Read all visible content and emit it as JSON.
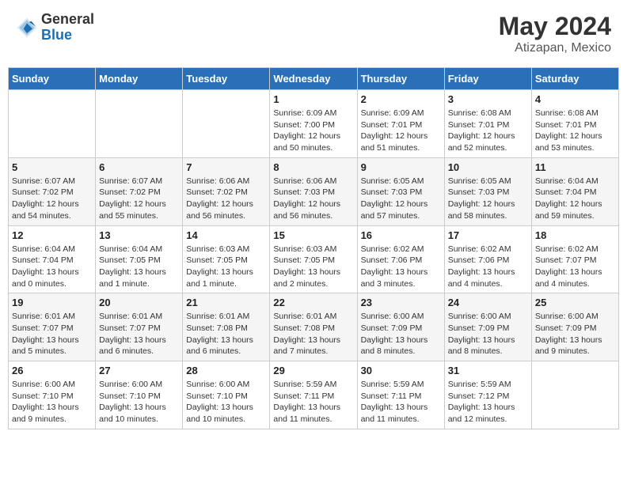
{
  "header": {
    "logo_general": "General",
    "logo_blue": "Blue",
    "month_year": "May 2024",
    "location": "Atizapan, Mexico"
  },
  "weekdays": [
    "Sunday",
    "Monday",
    "Tuesday",
    "Wednesday",
    "Thursday",
    "Friday",
    "Saturday"
  ],
  "weeks": [
    [
      {
        "day": "",
        "info": ""
      },
      {
        "day": "",
        "info": ""
      },
      {
        "day": "",
        "info": ""
      },
      {
        "day": "1",
        "info": "Sunrise: 6:09 AM\nSunset: 7:00 PM\nDaylight: 12 hours\nand 50 minutes."
      },
      {
        "day": "2",
        "info": "Sunrise: 6:09 AM\nSunset: 7:01 PM\nDaylight: 12 hours\nand 51 minutes."
      },
      {
        "day": "3",
        "info": "Sunrise: 6:08 AM\nSunset: 7:01 PM\nDaylight: 12 hours\nand 52 minutes."
      },
      {
        "day": "4",
        "info": "Sunrise: 6:08 AM\nSunset: 7:01 PM\nDaylight: 12 hours\nand 53 minutes."
      }
    ],
    [
      {
        "day": "5",
        "info": "Sunrise: 6:07 AM\nSunset: 7:02 PM\nDaylight: 12 hours\nand 54 minutes."
      },
      {
        "day": "6",
        "info": "Sunrise: 6:07 AM\nSunset: 7:02 PM\nDaylight: 12 hours\nand 55 minutes."
      },
      {
        "day": "7",
        "info": "Sunrise: 6:06 AM\nSunset: 7:02 PM\nDaylight: 12 hours\nand 56 minutes."
      },
      {
        "day": "8",
        "info": "Sunrise: 6:06 AM\nSunset: 7:03 PM\nDaylight: 12 hours\nand 56 minutes."
      },
      {
        "day": "9",
        "info": "Sunrise: 6:05 AM\nSunset: 7:03 PM\nDaylight: 12 hours\nand 57 minutes."
      },
      {
        "day": "10",
        "info": "Sunrise: 6:05 AM\nSunset: 7:03 PM\nDaylight: 12 hours\nand 58 minutes."
      },
      {
        "day": "11",
        "info": "Sunrise: 6:04 AM\nSunset: 7:04 PM\nDaylight: 12 hours\nand 59 minutes."
      }
    ],
    [
      {
        "day": "12",
        "info": "Sunrise: 6:04 AM\nSunset: 7:04 PM\nDaylight: 13 hours\nand 0 minutes."
      },
      {
        "day": "13",
        "info": "Sunrise: 6:04 AM\nSunset: 7:05 PM\nDaylight: 13 hours\nand 1 minute."
      },
      {
        "day": "14",
        "info": "Sunrise: 6:03 AM\nSunset: 7:05 PM\nDaylight: 13 hours\nand 1 minute."
      },
      {
        "day": "15",
        "info": "Sunrise: 6:03 AM\nSunset: 7:05 PM\nDaylight: 13 hours\nand 2 minutes."
      },
      {
        "day": "16",
        "info": "Sunrise: 6:02 AM\nSunset: 7:06 PM\nDaylight: 13 hours\nand 3 minutes."
      },
      {
        "day": "17",
        "info": "Sunrise: 6:02 AM\nSunset: 7:06 PM\nDaylight: 13 hours\nand 4 minutes."
      },
      {
        "day": "18",
        "info": "Sunrise: 6:02 AM\nSunset: 7:07 PM\nDaylight: 13 hours\nand 4 minutes."
      }
    ],
    [
      {
        "day": "19",
        "info": "Sunrise: 6:01 AM\nSunset: 7:07 PM\nDaylight: 13 hours\nand 5 minutes."
      },
      {
        "day": "20",
        "info": "Sunrise: 6:01 AM\nSunset: 7:07 PM\nDaylight: 13 hours\nand 6 minutes."
      },
      {
        "day": "21",
        "info": "Sunrise: 6:01 AM\nSunset: 7:08 PM\nDaylight: 13 hours\nand 6 minutes."
      },
      {
        "day": "22",
        "info": "Sunrise: 6:01 AM\nSunset: 7:08 PM\nDaylight: 13 hours\nand 7 minutes."
      },
      {
        "day": "23",
        "info": "Sunrise: 6:00 AM\nSunset: 7:09 PM\nDaylight: 13 hours\nand 8 minutes."
      },
      {
        "day": "24",
        "info": "Sunrise: 6:00 AM\nSunset: 7:09 PM\nDaylight: 13 hours\nand 8 minutes."
      },
      {
        "day": "25",
        "info": "Sunrise: 6:00 AM\nSunset: 7:09 PM\nDaylight: 13 hours\nand 9 minutes."
      }
    ],
    [
      {
        "day": "26",
        "info": "Sunrise: 6:00 AM\nSunset: 7:10 PM\nDaylight: 13 hours\nand 9 minutes."
      },
      {
        "day": "27",
        "info": "Sunrise: 6:00 AM\nSunset: 7:10 PM\nDaylight: 13 hours\nand 10 minutes."
      },
      {
        "day": "28",
        "info": "Sunrise: 6:00 AM\nSunset: 7:10 PM\nDaylight: 13 hours\nand 10 minutes."
      },
      {
        "day": "29",
        "info": "Sunrise: 5:59 AM\nSunset: 7:11 PM\nDaylight: 13 hours\nand 11 minutes."
      },
      {
        "day": "30",
        "info": "Sunrise: 5:59 AM\nSunset: 7:11 PM\nDaylight: 13 hours\nand 11 minutes."
      },
      {
        "day": "31",
        "info": "Sunrise: 5:59 AM\nSunset: 7:12 PM\nDaylight: 13 hours\nand 12 minutes."
      },
      {
        "day": "",
        "info": ""
      }
    ]
  ]
}
